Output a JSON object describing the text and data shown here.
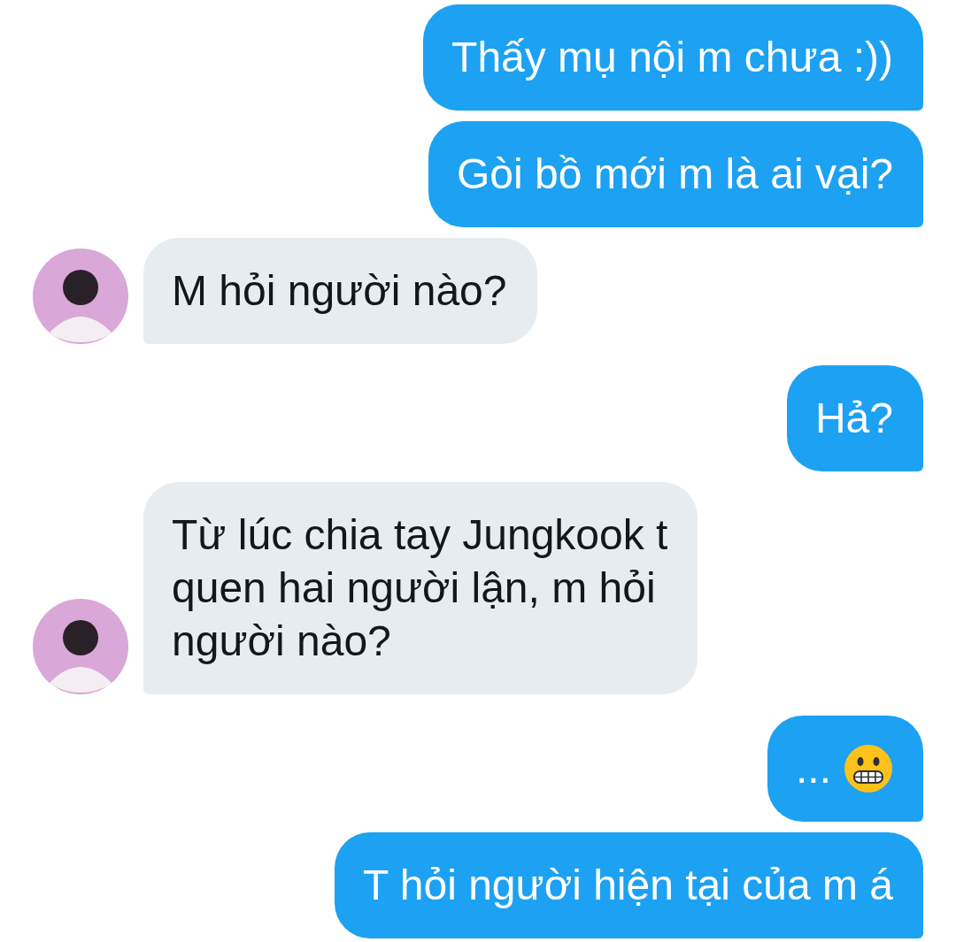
{
  "messages": [
    {
      "outgoing": true,
      "kind": "text",
      "text": "Thấy mụ nội m chưa :))"
    },
    {
      "outgoing": true,
      "kind": "text",
      "text": "Gòi bồ mới m là ai vại?"
    },
    {
      "outgoing": false,
      "kind": "text",
      "text": "M hỏi người nào?"
    },
    {
      "outgoing": true,
      "kind": "text",
      "text": "Hả?"
    },
    {
      "outgoing": false,
      "kind": "text",
      "text": "Từ lúc chia tay Jungkook t\nquen hai người lận, m hỏi\nngười nào?"
    },
    {
      "outgoing": true,
      "kind": "text_with_icon",
      "text": "..."
    },
    {
      "outgoing": true,
      "kind": "text",
      "text": "T hỏi người hiện tại của m á"
    }
  ]
}
